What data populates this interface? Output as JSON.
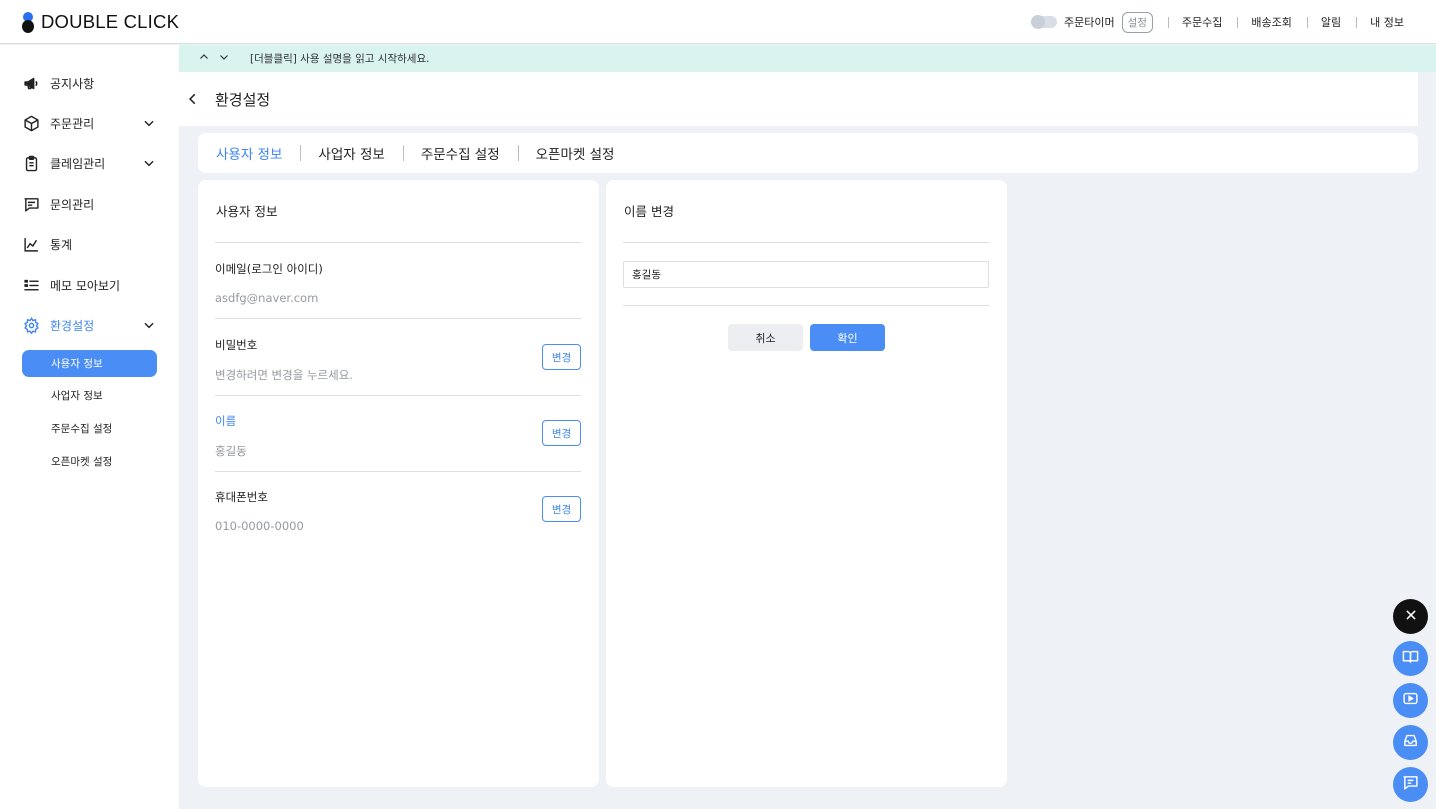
{
  "header": {
    "logo_text": "DOUBLE CLICK",
    "order_timer_label": "주문타이머",
    "settings_label": "설정",
    "links": [
      "주문수집",
      "배송조회",
      "알림",
      "내 정보"
    ]
  },
  "sidebar": {
    "items": [
      {
        "label": "공지사항",
        "icon": "megaphone-icon"
      },
      {
        "label": "주문관리",
        "icon": "box-icon",
        "expandable": true
      },
      {
        "label": "클레임관리",
        "icon": "clipboard-icon",
        "expandable": true
      },
      {
        "label": "문의관리",
        "icon": "chat-icon"
      },
      {
        "label": "통계",
        "icon": "chart-icon"
      },
      {
        "label": "메모 모아보기",
        "icon": "memo-icon"
      },
      {
        "label": "환경설정",
        "icon": "gear-icon",
        "expandable": true,
        "active": true
      }
    ],
    "sub_items": [
      {
        "label": "사용자 정보",
        "active": true
      },
      {
        "label": "사업자 정보"
      },
      {
        "label": "주문수집 설정"
      },
      {
        "label": "오픈마켓 설정"
      }
    ]
  },
  "notice": {
    "text": "[더블클릭] 사용 설명을 읽고 시작하세요."
  },
  "page": {
    "title": "환경설정"
  },
  "tabs": [
    {
      "label": "사용자 정보",
      "active": true
    },
    {
      "label": "사업자 정보"
    },
    {
      "label": "주문수집 설정"
    },
    {
      "label": "오픈마켓 설정"
    }
  ],
  "user_info": {
    "title": "사용자 정보",
    "change_label": "변경",
    "fields": [
      {
        "label": "이메일(로그인 아이디)",
        "value": "asdfg@naver.com"
      },
      {
        "label": "비밀번호",
        "value": "변경하려면 변경을 누르세요."
      },
      {
        "label": "이름",
        "value": "홍길동"
      },
      {
        "label": "휴대폰번호",
        "value": "010-0000-0000"
      }
    ]
  },
  "name_change": {
    "title": "이름 변경",
    "input_value": "홍길동",
    "cancel_label": "취소",
    "confirm_label": "확인"
  },
  "colors": {
    "accent": "#4a8df4",
    "notice_bg": "#d9f3ee",
    "page_bg": "#eef1f6"
  },
  "floating_buttons": [
    "close-icon",
    "book-icon",
    "play-icon",
    "inbox-icon",
    "message-icon"
  ]
}
